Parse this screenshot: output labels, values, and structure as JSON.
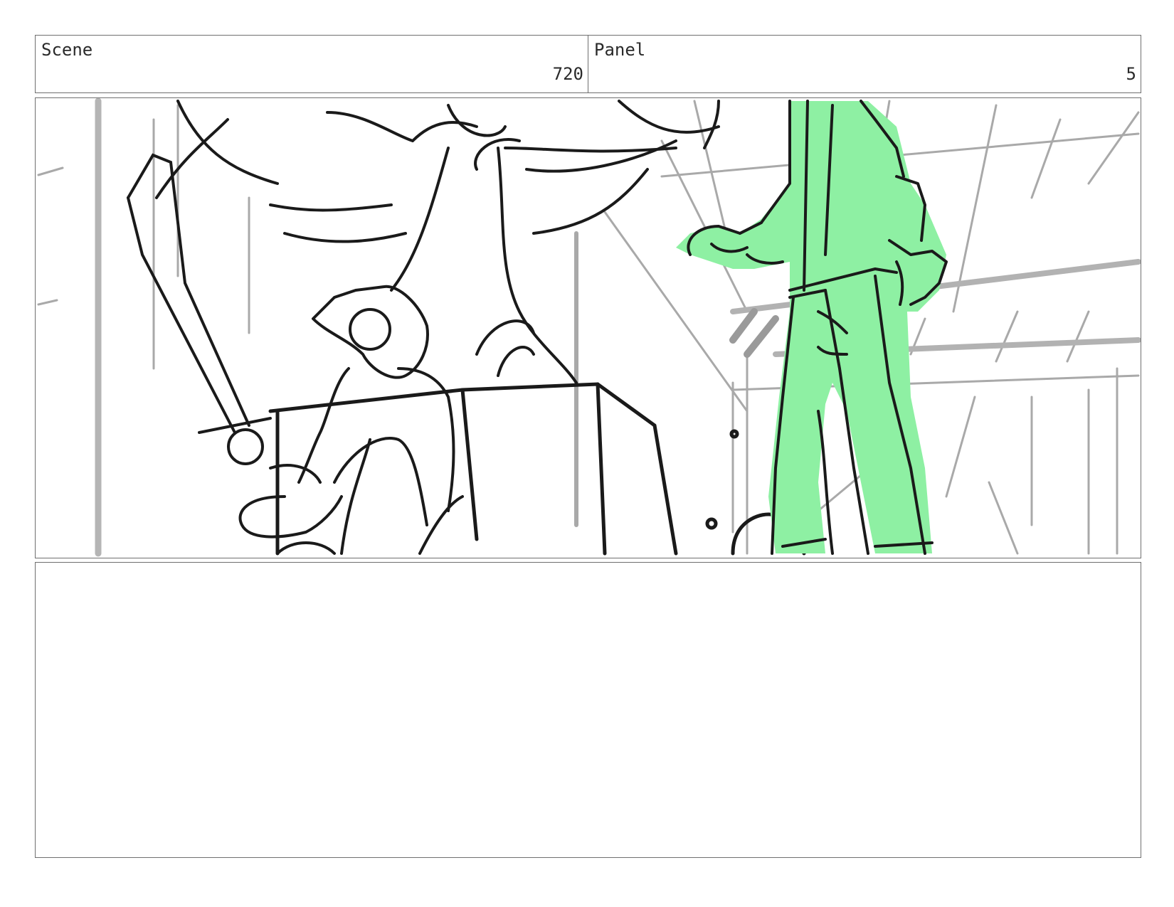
{
  "header": {
    "scene_label": "Scene",
    "scene_value": "720",
    "panel_label": "Panel",
    "panel_value": "5"
  },
  "notes": {
    "text": ""
  },
  "colors": {
    "figure_fill": "#8ef0a3",
    "line": "#1a1a1a",
    "background_lines": "#a8a8a8",
    "border": "#6f6f6f"
  }
}
